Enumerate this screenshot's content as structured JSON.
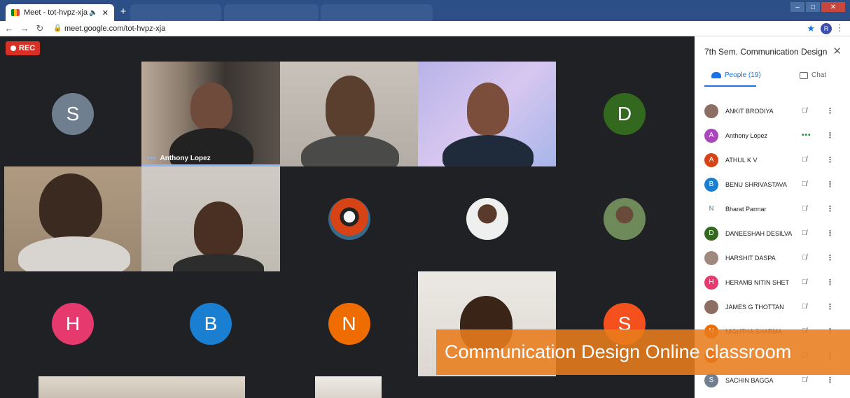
{
  "browser": {
    "active_tab": {
      "title": "Meet - tot-hvpz-xja",
      "audio_icon": "speaker-icon"
    },
    "url": "meet.google.com/tot-hvpz-xja",
    "profile_initial": "R"
  },
  "meeting": {
    "rec_label": "REC",
    "speaker_name": "Anthony Lopez",
    "tiles": [
      {
        "type": "letter",
        "letter": "S",
        "color": "#6f7f8f"
      },
      {
        "type": "video",
        "label": "Anthony Lopez"
      },
      {
        "type": "video"
      },
      {
        "type": "video"
      },
      {
        "type": "letter",
        "letter": "D",
        "color": "#33691e"
      },
      {
        "type": "video"
      },
      {
        "type": "video"
      },
      {
        "type": "photo"
      },
      {
        "type": "photo"
      },
      {
        "type": "photo"
      },
      {
        "type": "letter",
        "letter": "H",
        "color": "#e63a6e"
      },
      {
        "type": "letter",
        "letter": "B",
        "color": "#1a7fd0"
      },
      {
        "type": "letter",
        "letter": "N",
        "color": "#ef6c00"
      },
      {
        "type": "video"
      },
      {
        "type": "letter",
        "letter": "S",
        "color": "#f4511e"
      }
    ]
  },
  "panel": {
    "title": "7th Sem. Communication Design ...",
    "tabs": {
      "people": "People (19)",
      "chat": "Chat"
    },
    "participants": [
      {
        "name": "ANKIT BRODIYA",
        "avatar": "photo",
        "color": "#8d6e63",
        "mic": "muted"
      },
      {
        "name": "Anthony Lopez",
        "avatar": "A",
        "color": "#ab47bc",
        "mic": "speaking"
      },
      {
        "name": "ATHUL K V",
        "avatar": "A",
        "color": "#d84315",
        "mic": "muted"
      },
      {
        "name": "BENU SHRIVASTAVA",
        "avatar": "B",
        "color": "#1a7fd0",
        "mic": "muted"
      },
      {
        "name": "Bharat Parmar",
        "avatar": "logo",
        "color": "#90a4ae",
        "mic": "muted"
      },
      {
        "name": "DANEESHAH DESILVA",
        "avatar": "D",
        "color": "#33691e",
        "mic": "muted"
      },
      {
        "name": "HARSHIT DASPA",
        "avatar": "photo",
        "color": "#a1887f",
        "mic": "muted"
      },
      {
        "name": "HERAMB NITIN SHET",
        "avatar": "H",
        "color": "#e63a6e",
        "mic": "muted"
      },
      {
        "name": "JAMES G THOTTAN",
        "avatar": "photo",
        "color": "#8d6e63",
        "mic": "muted"
      },
      {
        "name": "NIGHTHA SHARMA",
        "avatar": "N",
        "color": "#ef6c00",
        "mic": "muted"
      },
      {
        "name": "",
        "avatar": "",
        "color": "#f4511e",
        "mic": "muted"
      },
      {
        "name": "SACHIN BAGGA",
        "avatar": "S",
        "color": "#6f7f8f",
        "mic": "muted"
      }
    ]
  },
  "caption": "Communication Design Online classroom"
}
